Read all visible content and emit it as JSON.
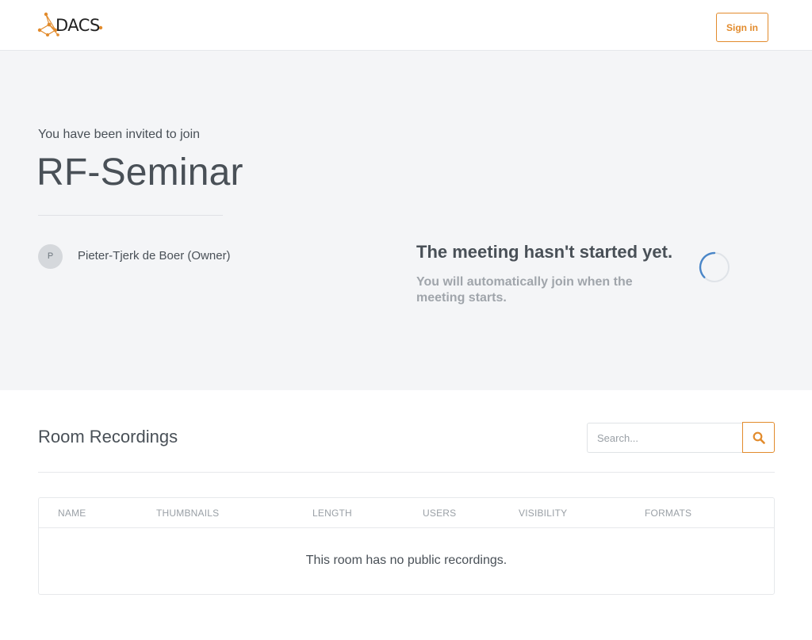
{
  "header": {
    "logo_text": "DACS",
    "signin_label": "Sign in",
    "accent_color": "#e28b2c"
  },
  "invite": {
    "label": "You have been invited to join",
    "room_name": "RF-Seminar",
    "owner_initial": "P",
    "owner_name": "Pieter-Tjerk de Boer (Owner)"
  },
  "meeting_status": {
    "title": "The meeting hasn't started yet.",
    "subtitle": "You will automatically join when the meeting starts.",
    "spinner_icon": "loading-spinner-icon"
  },
  "recordings": {
    "title": "Room Recordings",
    "search": {
      "placeholder": "Search...",
      "value": "",
      "icon": "search-icon"
    },
    "columns": [
      "NAME",
      "THUMBNAILS",
      "LENGTH",
      "USERS",
      "VISIBILITY",
      "FORMATS"
    ],
    "empty_message": "This room has no public recordings."
  }
}
